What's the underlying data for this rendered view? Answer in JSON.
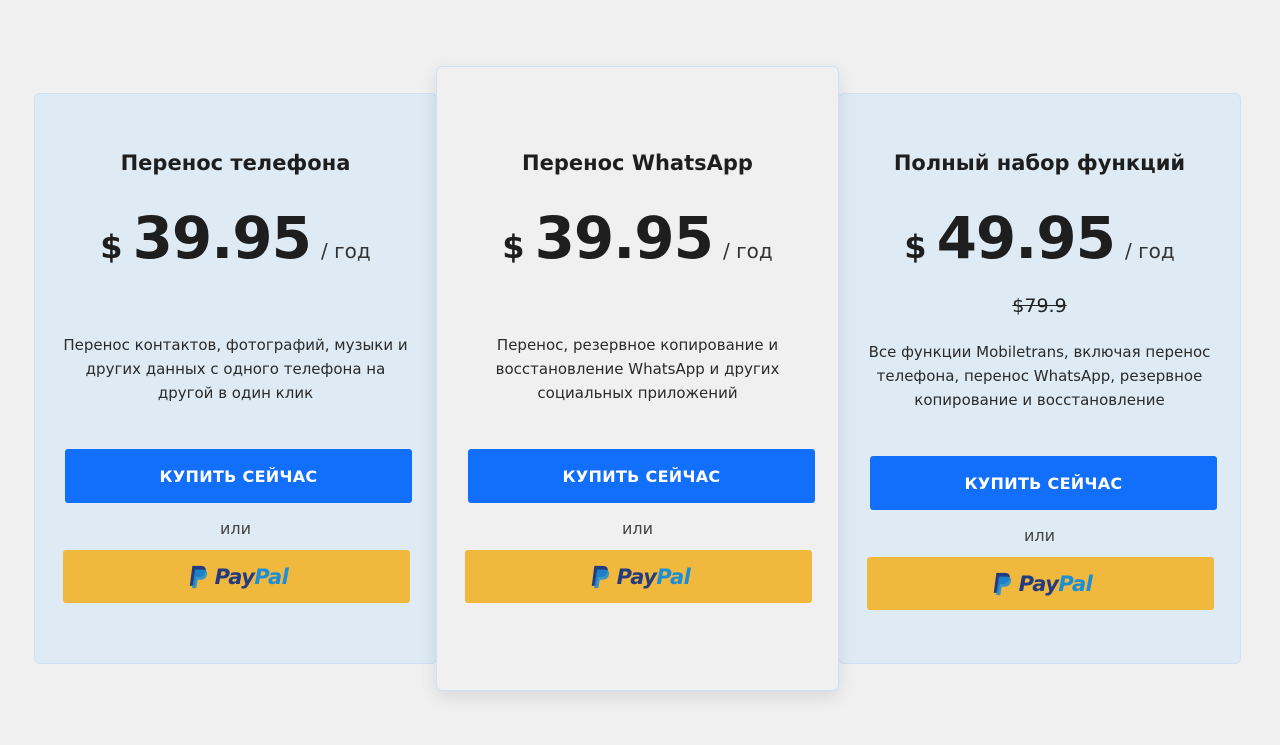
{
  "plans": [
    {
      "title": "Перенос телефона",
      "currency": "$",
      "amount": "39.95",
      "period": "/ год",
      "old_price": "",
      "description": "Перенос контактов, фотографий, музыки и других данных с одного телефона на другой в один клик",
      "buy_label": "КУПИТЬ СЕЙЧАС",
      "or_label": "или",
      "paypal_pay": "Pay",
      "paypal_pal": "Pal"
    },
    {
      "title": "Перенос WhatsApp",
      "currency": "$",
      "amount": "39.95",
      "period": "/ год",
      "old_price": "",
      "description": "Перенос, резервное копирование и восстановление WhatsApp и других социальных приложений",
      "buy_label": "КУПИТЬ СЕЙЧАС",
      "or_label": "или",
      "paypal_pay": "Pay",
      "paypal_pal": "Pal"
    },
    {
      "title": "Полный набор функций",
      "currency": "$",
      "amount": "49.95",
      "period": "/ год",
      "old_price": "$79.9",
      "description": "Все функции Mobiletrans, включая перенос телефона, перенос WhatsApp, резервное копирование и восстановление",
      "buy_label": "КУПИТЬ СЕЙЧАС",
      "or_label": "или",
      "paypal_pay": "Pay",
      "paypal_pal": "Pal"
    }
  ],
  "colors": {
    "page_bg": "#f0f0f0",
    "card_bg": "#deebf4",
    "buy_button": "#116ffb",
    "paypal_button": "#f0b93e",
    "paypal_dark": "#243b80",
    "paypal_light": "#1c8ed7"
  },
  "icons": {
    "paypal": "paypal-logo-icon"
  }
}
